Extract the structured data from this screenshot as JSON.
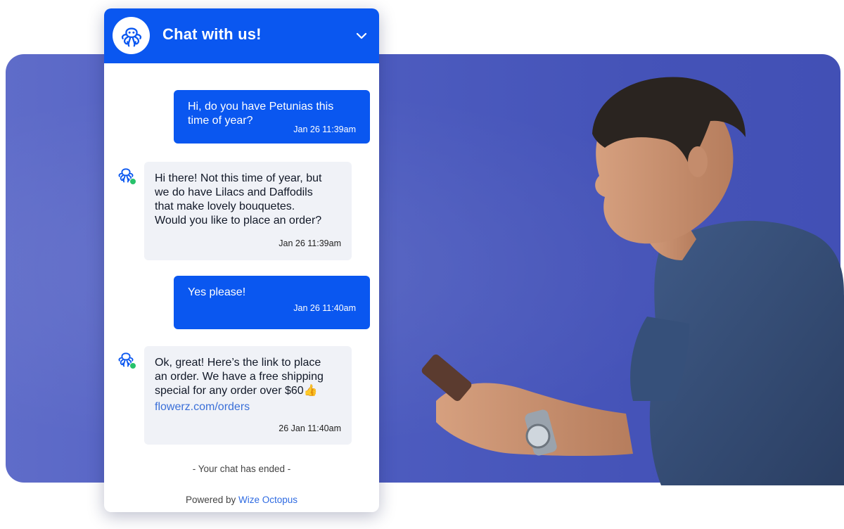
{
  "colors": {
    "brand_blue": "#0a57f0",
    "backdrop_blue": "#4a58bc",
    "agent_bubble": "#f0f2f7",
    "online": "#27c26b",
    "link": "#3a6fd8"
  },
  "header": {
    "title": "Chat with us!",
    "avatar_icon": "octopus-logo-icon",
    "collapse_icon": "chevron-down-icon"
  },
  "messages": [
    {
      "sender": "user",
      "text": "Hi, do you have Petunias this\ntime of year?",
      "time": "Jan 26 11:39am"
    },
    {
      "sender": "agent",
      "text": "Hi there! Not this time of year, but\nwe do have Lilacs and Daffodils\nthat make lovely bouquetes.\nWould you like to place an order?",
      "time": "Jan 26 11:39am"
    },
    {
      "sender": "user",
      "text": "Yes please!",
      "time": "Jan 26 11:40am"
    },
    {
      "sender": "agent",
      "text": "Ok, great! Here’s the link to place\nan order. We have a free shipping\nspecial for any order over $60👍",
      "link": "flowerz.com/orders",
      "time": "26 Jan 11:40am"
    }
  ],
  "footer": {
    "status": "- Your chat has ended -",
    "powered_prefix": "Powered by",
    "powered_brand": "Wize Octopus"
  }
}
